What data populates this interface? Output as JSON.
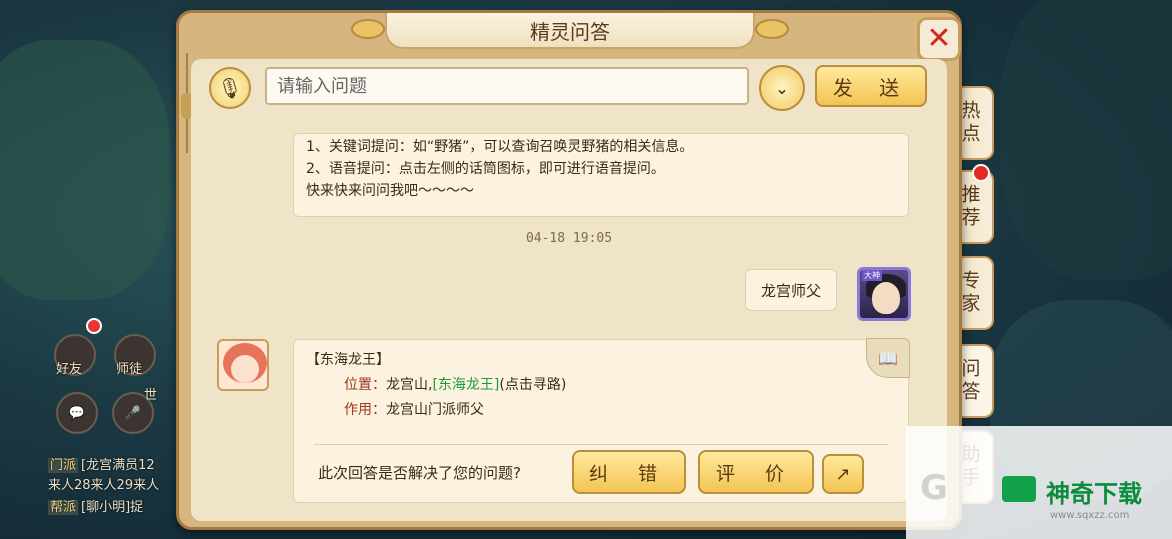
{
  "window": {
    "title": "精灵问答"
  },
  "input": {
    "placeholder": "请输入问题",
    "send_label": "发 送"
  },
  "side_tabs": [
    {
      "label": "热点"
    },
    {
      "label": "推荐"
    },
    {
      "label": "专家"
    },
    {
      "label": "问答"
    },
    {
      "label": "助手"
    }
  ],
  "intro": {
    "lines": [
      "1、关键词提问：如“野猪”，可以查询召唤灵野猪的相关信息。",
      "2、语音提问：点击左侧的话筒图标，即可进行语音提问。",
      "快来快来问问我吧～～～～"
    ]
  },
  "timestamp": "04-18 19:05",
  "user_message": "龙宫师父",
  "user_avatar_tag": "大神",
  "answer": {
    "title": "【东海龙王】",
    "location_label": "位置：",
    "location_value": "龙宫山,",
    "location_link": "[东海龙王]",
    "location_hint": "(点击寻路)",
    "role_label": "作用：",
    "role_value": "龙宫山门派师父"
  },
  "feedback": {
    "question": "此次回答是否解决了您的问题?",
    "fix_label": "纠 错",
    "rate_label": "评 价"
  },
  "hud": {
    "friends_label": "好友",
    "mentor_label": "师徒",
    "world_label": "世",
    "chat_lines": [
      {
        "tag": "门派",
        "text": "[龙宫满员12"
      },
      {
        "tag": "",
        "text": "来人28来人29来人"
      },
      {
        "tag": "帮派",
        "text": "[聊小明]捉"
      }
    ]
  },
  "watermark": {
    "title": "神奇下载",
    "url": "www.sqxzz.com"
  }
}
